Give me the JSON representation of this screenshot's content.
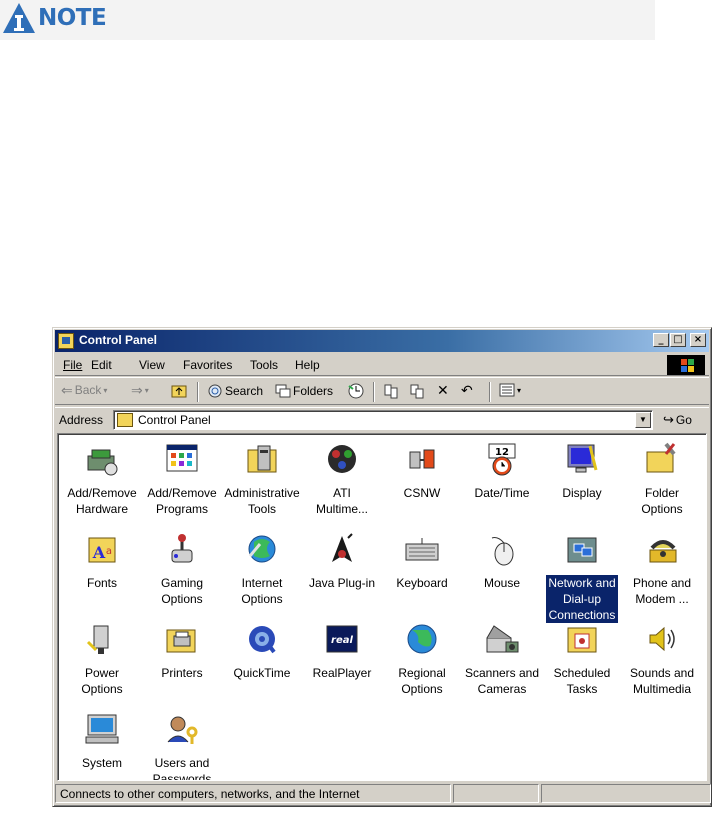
{
  "note": {
    "label": "NOTE"
  },
  "window": {
    "title": "Control Panel",
    "controls": {
      "minimize": "_",
      "maximize": "□",
      "close": "×"
    }
  },
  "menu": [
    {
      "label": "File"
    },
    {
      "label": "Edit"
    },
    {
      "label": "View"
    },
    {
      "label": "Favorites"
    },
    {
      "label": "Tools"
    },
    {
      "label": "Help"
    }
  ],
  "toolbar": {
    "back": "Back",
    "search": "Search",
    "folders": "Folders"
  },
  "address": {
    "label": "Address",
    "value": "Control Panel",
    "go": "Go"
  },
  "icons": [
    {
      "line1": "Add/Remove",
      "line2": "Hardware",
      "icon": "add-remove-hardware-icon"
    },
    {
      "line1": "Add/Remove",
      "line2": "Programs",
      "icon": "add-remove-programs-icon"
    },
    {
      "line1": "Administrative",
      "line2": "Tools",
      "icon": "administrative-tools-icon"
    },
    {
      "line1": "ATI",
      "line2": "Multime...",
      "icon": "ati-multimedia-icon"
    },
    {
      "line1": "CSNW",
      "line2": "",
      "icon": "csnw-icon"
    },
    {
      "line1": "Date/Time",
      "line2": "",
      "icon": "date-time-icon"
    },
    {
      "line1": "Display",
      "line2": "",
      "icon": "display-icon"
    },
    {
      "line1": "Folder",
      "line2": "Options",
      "icon": "folder-options-icon"
    },
    {
      "line1": "Fonts",
      "line2": "",
      "icon": "fonts-icon"
    },
    {
      "line1": "Gaming",
      "line2": "Options",
      "icon": "gaming-options-icon"
    },
    {
      "line1": "Internet",
      "line2": "Options",
      "icon": "internet-options-icon"
    },
    {
      "line1": "Java Plug-in",
      "line2": "",
      "icon": "java-plugin-icon"
    },
    {
      "line1": "Keyboard",
      "line2": "",
      "icon": "keyboard-icon"
    },
    {
      "line1": "Mouse",
      "line2": "",
      "icon": "mouse-icon"
    },
    {
      "line1": "Network and",
      "line2": "Dial-up",
      "line3": "Connections",
      "icon": "network-connections-icon",
      "selected": true
    },
    {
      "line1": "Phone and",
      "line2": "Modem ...",
      "icon": "phone-modem-icon"
    },
    {
      "line1": "Power",
      "line2": "Options",
      "icon": "power-options-icon"
    },
    {
      "line1": "Printers",
      "line2": "",
      "icon": "printers-icon"
    },
    {
      "line1": "QuickTime",
      "line2": "",
      "icon": "quicktime-icon"
    },
    {
      "line1": "RealPlayer",
      "line2": "",
      "icon": "realplayer-icon"
    },
    {
      "line1": "Regional",
      "line2": "Options",
      "icon": "regional-options-icon"
    },
    {
      "line1": "Scanners and",
      "line2": "Cameras",
      "icon": "scanners-cameras-icon"
    },
    {
      "line1": "Scheduled",
      "line2": "Tasks",
      "icon": "scheduled-tasks-icon"
    },
    {
      "line1": "Sounds and",
      "line2": "Multimedia",
      "icon": "sounds-multimedia-icon"
    },
    {
      "line1": "System",
      "line2": "",
      "icon": "system-icon"
    },
    {
      "line1": "Users and",
      "line2": "Passwords",
      "icon": "users-passwords-icon"
    }
  ],
  "status": {
    "text": "Connects to other computers, networks, and the Internet"
  },
  "colors": {
    "note_blue": "#2f6fb8",
    "title_start": "#0a246a",
    "title_end": "#a6caf0",
    "face": "#d4d0c8",
    "selection": "#0a246a"
  }
}
